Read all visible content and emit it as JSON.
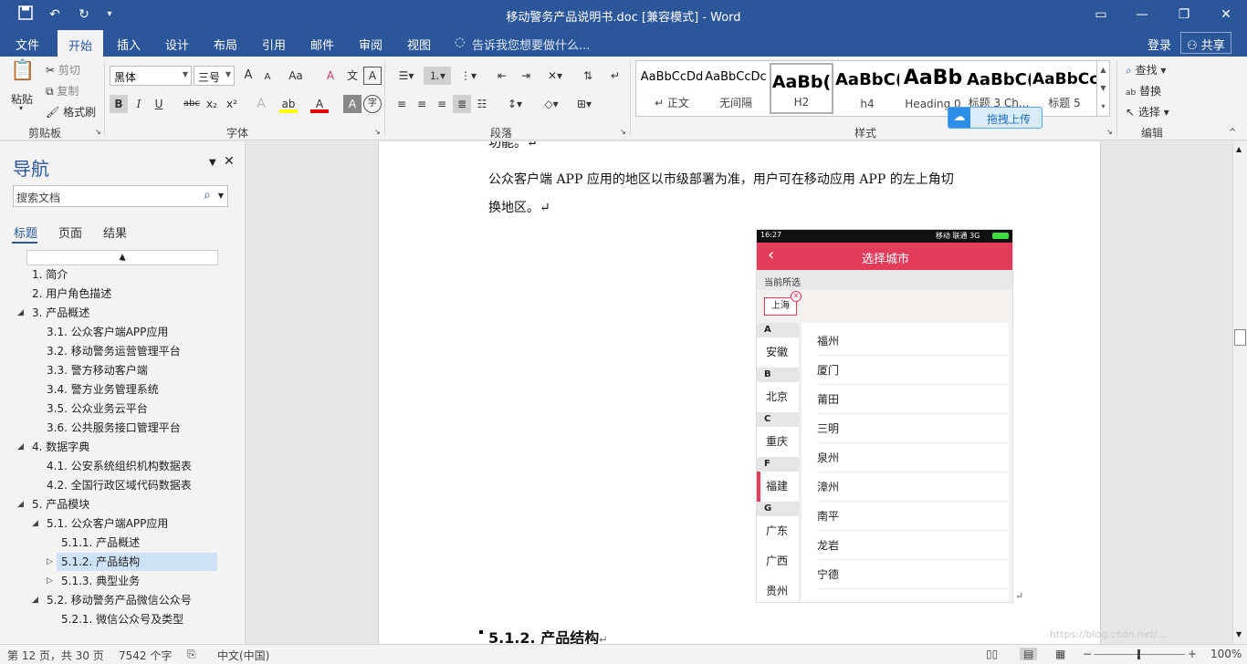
{
  "window": {
    "title": "移动警务产品说明书.doc [兼容模式] - Word"
  },
  "tabs": {
    "file": "文件",
    "home": "开始",
    "insert": "插入",
    "design": "设计",
    "layout": "布局",
    "references": "引用",
    "mailings": "邮件",
    "review": "审阅",
    "view": "视图",
    "tell_me": "告诉我您想要做什么...",
    "login": "登录",
    "share": "共享"
  },
  "ribbon": {
    "clipboard": {
      "paste": "粘贴",
      "cut": "剪切",
      "copy": "复制",
      "format_painter": "格式刷",
      "group": "剪贴板"
    },
    "font": {
      "name": "黑体",
      "size": "三号",
      "group": "字体",
      "change_case": "Aa",
      "grow": "A",
      "shrink": "A",
      "clear": "A",
      "wen": "文",
      "boxA": "A",
      "bold": "B",
      "italic": "I",
      "underline": "U",
      "strike": "abc",
      "sub": "x₂",
      "sup": "x²",
      "texteffect": "A",
      "highlight": "ab",
      "fontcolor": "A",
      "shadeA": "A",
      "enclose": "字"
    },
    "paragraph": {
      "group": "段落"
    },
    "styles": {
      "group": "样式",
      "items": [
        {
          "preview": "AaBbCcDd",
          "name": "↵ 正文"
        },
        {
          "preview": "AaBbCcDc",
          "name": "无间隔"
        },
        {
          "preview": "AaBb(",
          "name": "H2"
        },
        {
          "preview": "AaBbC(",
          "name": "h4"
        },
        {
          "preview": "AaBb",
          "name": "Heading 0"
        },
        {
          "preview": "AaBbC(",
          "name": "标题 3 Ch..."
        },
        {
          "preview": "AaBbCc",
          "name": "标题 5"
        }
      ]
    },
    "editing": {
      "find": "查找",
      "replace": "替换",
      "select": "选择",
      "group": "编辑"
    },
    "upload": "拖拽上传"
  },
  "nav": {
    "title": "导航",
    "search_placeholder": "搜索文档",
    "tabs": {
      "headings": "标题",
      "pages": "页面",
      "results": "结果"
    },
    "items": [
      {
        "label": "1. 简介"
      },
      {
        "label": "2. 用户角色描述"
      },
      {
        "label": "3. 产品概述"
      },
      {
        "label": "3.1. 公众客户端APP应用"
      },
      {
        "label": "3.2. 移动警务运营管理平台"
      },
      {
        "label": "3.3. 警方移动客户端"
      },
      {
        "label": "3.4. 警方业务管理系统"
      },
      {
        "label": "3.5. 公众业务云平台"
      },
      {
        "label": "3.6. 公共服务接口管理平台"
      },
      {
        "label": "4. 数据字典"
      },
      {
        "label": "4.1. 公安系统组织机构数据表"
      },
      {
        "label": "4.2. 全国行政区域代码数据表"
      },
      {
        "label": "5. 产品模块"
      },
      {
        "label": "5.1. 公众客户端APP应用"
      },
      {
        "label": "5.1.1. 产品概述"
      },
      {
        "label": "5.1.2. 产品结构"
      },
      {
        "label": "5.1.3. 典型业务"
      },
      {
        "label": "5.2. 移动警务产品微信公众号"
      },
      {
        "label": "5.2.1. 微信公众号及类型"
      }
    ]
  },
  "document": {
    "line0": "功能。↵",
    "line1": "公众客户端 APP 应用的地区以市级部署为准，用户可在移动应用 APP 的左上角切",
    "line2": "换地区。↵",
    "heading": "5.1.2. 产品结构",
    "heading_mark": "↵",
    "para_mark": "↵"
  },
  "phone": {
    "time": "16:27",
    "status_right": "移动  联通 3G",
    "title": "选择城市",
    "current_label": "当前所选",
    "current_city": "上海",
    "left": [
      {
        "h": "A",
        "c": "安徽"
      },
      {
        "h": "B",
        "c": "北京"
      },
      {
        "h": "C",
        "c": "重庆"
      },
      {
        "h": "F",
        "c": "福建"
      },
      {
        "h": "G",
        "c": "广东"
      },
      {
        "c2": "广西"
      },
      {
        "c3": "贵州"
      }
    ],
    "right": [
      "福州",
      "厦门",
      "莆田",
      "三明",
      "泉州",
      "漳州",
      "南平",
      "龙岩",
      "宁德"
    ],
    "highlight_color": "#e23c5a"
  },
  "status": {
    "page": "第 12 页，共 30 页",
    "words": "7542 个字",
    "lang": "中文(中国)",
    "zoom": "100%",
    "watermark": "https://blog.csdn.net/..."
  }
}
